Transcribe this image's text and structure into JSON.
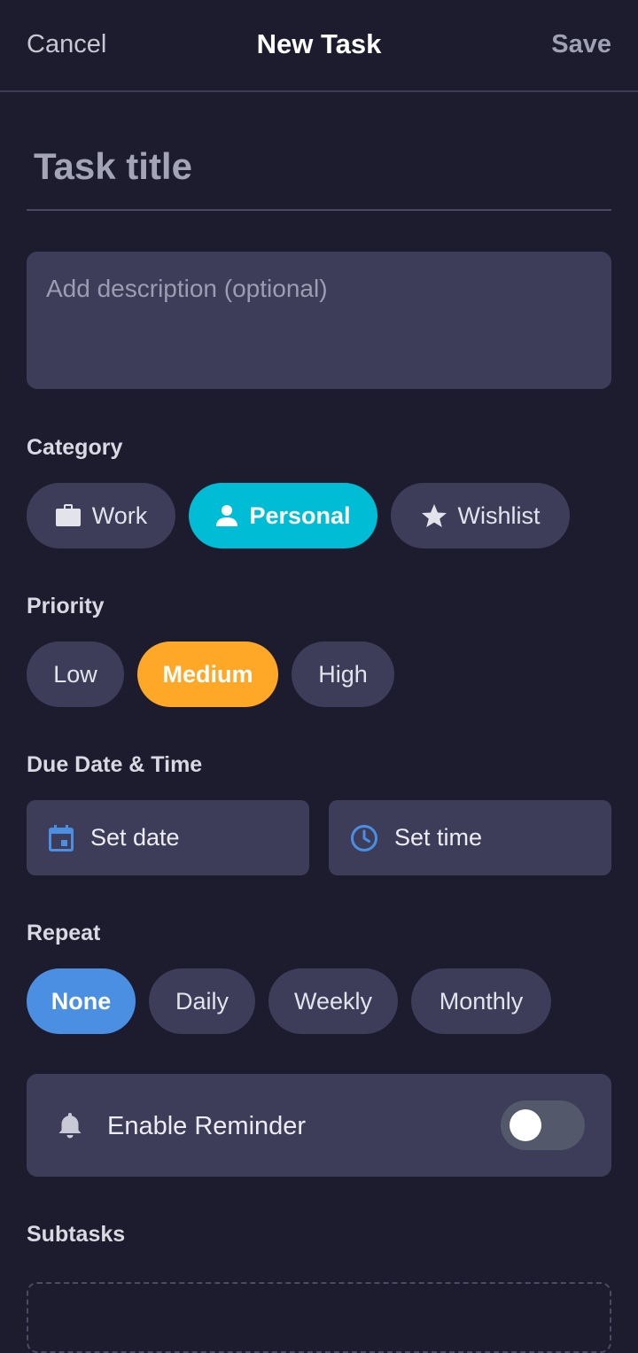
{
  "header": {
    "cancel_label": "Cancel",
    "title": "New Task",
    "save_label": "Save"
  },
  "title_input": {
    "placeholder": "Task title",
    "value": ""
  },
  "description": {
    "placeholder": "Add description (optional)",
    "value": ""
  },
  "category": {
    "label": "Category",
    "options": [
      {
        "label": "Work",
        "icon": "briefcase-icon",
        "selected": false
      },
      {
        "label": "Personal",
        "icon": "person-icon",
        "selected": true
      },
      {
        "label": "Wishlist",
        "icon": "star-icon",
        "selected": false
      }
    ]
  },
  "priority": {
    "label": "Priority",
    "options": [
      {
        "label": "Low",
        "selected": false
      },
      {
        "label": "Medium",
        "selected": true
      },
      {
        "label": "High",
        "selected": false
      }
    ]
  },
  "due": {
    "label": "Due Date & Time",
    "date_label": "Set date",
    "time_label": "Set time"
  },
  "repeat": {
    "label": "Repeat",
    "options": [
      {
        "label": "None",
        "selected": true
      },
      {
        "label": "Daily",
        "selected": false
      },
      {
        "label": "Weekly",
        "selected": false
      },
      {
        "label": "Monthly",
        "selected": false
      }
    ]
  },
  "reminder": {
    "label": "Enable Reminder",
    "enabled": false
  },
  "subtasks": {
    "label": "Subtasks"
  },
  "colors": {
    "background": "#1c1c2e",
    "surface": "#3d3d5a",
    "category_selected": "#00bcd4",
    "priority_selected": "#ffa726",
    "repeat_selected": "#4a8fe2",
    "icon_accent": "#4a8fe2"
  }
}
